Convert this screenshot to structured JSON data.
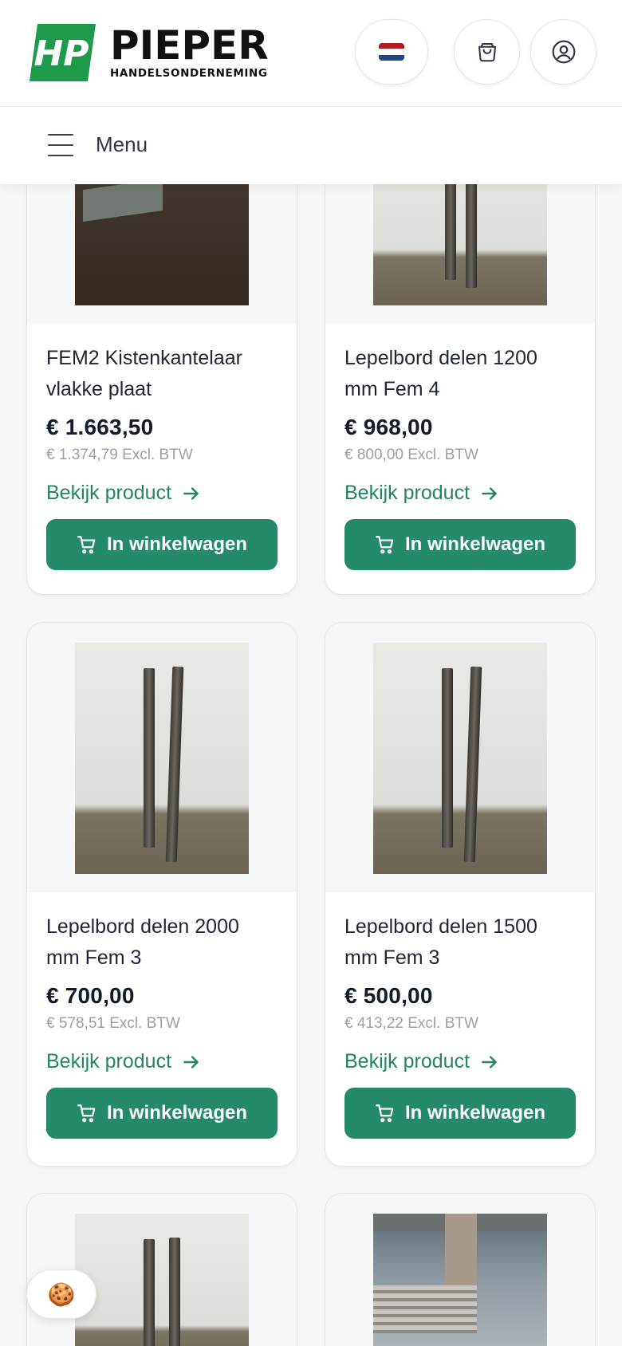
{
  "header": {
    "logo_initials": "HP",
    "logo_name": "PIEPER",
    "logo_subtitle": "HANDELSONDERNEMING",
    "language_icon": "flag-nl-icon",
    "cart_icon": "shopping-bag-icon",
    "account_icon": "user-circle-icon",
    "brand_color": "#1f9a4a"
  },
  "menubar": {
    "label": "Menu",
    "icon": "hamburger-icon"
  },
  "colors": {
    "accent": "#258a6b",
    "link": "#238566",
    "muted": "#9aa0a8"
  },
  "products": [
    {
      "title": "FEM2 Kistenkantelaar vlakke plaat",
      "price": "€ 1.663,50",
      "price_excl": "€ 1.374,79 Excl. BTW",
      "link_label": "Bekijk product",
      "button_label": "In winkelwagen",
      "image": "forklift-tilter-on-ground"
    },
    {
      "title": "Lepelbord delen 1200 mm Fem 4",
      "price": "€ 968,00",
      "price_excl": "€ 800,00 Excl. BTW",
      "link_label": "Bekijk product",
      "button_label": "In winkelwagen",
      "image": "two-steel-bars-against-wall"
    },
    {
      "title": "Lepelbord delen 2000 mm Fem 3",
      "price": "€ 700,00",
      "price_excl": "€ 578,51 Excl. BTW",
      "link_label": "Bekijk product",
      "button_label": "In winkelwagen",
      "image": "two-steel-bars-against-wall"
    },
    {
      "title": "Lepelbord delen 1500 mm Fem 3",
      "price": "€ 500,00",
      "price_excl": "€ 413,22 Excl. BTW",
      "link_label": "Bekijk product",
      "button_label": "In winkelwagen",
      "image": "two-steel-bars-against-wall"
    },
    {
      "image": "two-steel-bars-against-wall"
    },
    {
      "image": "industrial-machine"
    }
  ],
  "cookie": {
    "icon": "cookie-icon",
    "glyph": "🍪"
  }
}
